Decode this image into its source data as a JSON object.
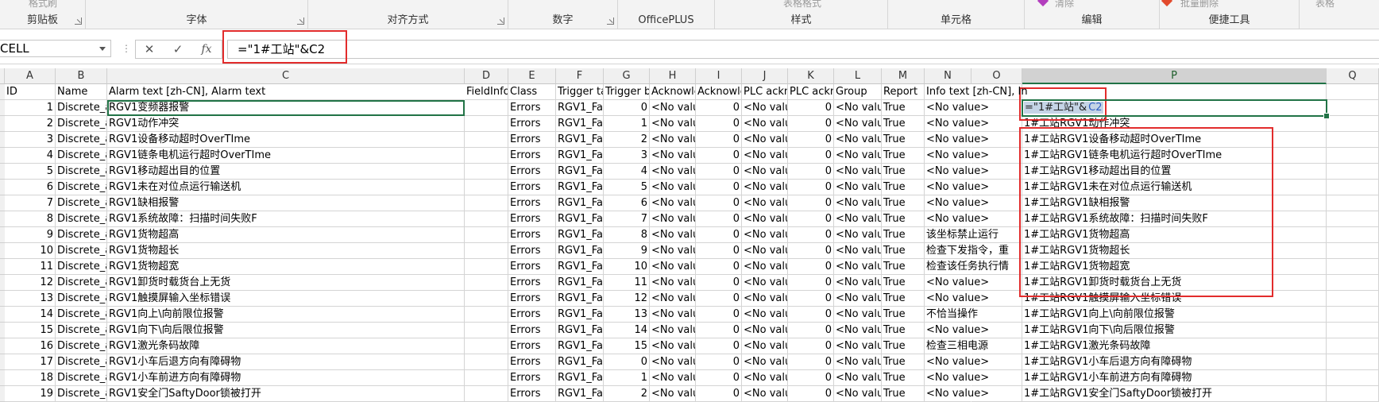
{
  "ribbon": {
    "groups": [
      {
        "label": "剪贴板",
        "faded": "格式刷"
      },
      {
        "label": "字体",
        "faded": ""
      },
      {
        "label": "对齐方式",
        "faded": ""
      },
      {
        "label": "数字",
        "faded": ""
      },
      {
        "label": "OfficePLUS",
        "faded": ""
      },
      {
        "label": "样式",
        "faded": "表格格式"
      },
      {
        "label": "单元格",
        "faded": ""
      },
      {
        "label": "编辑",
        "faded": "清除"
      },
      {
        "label": "便捷工具",
        "faded": "批量删除"
      },
      {
        "label": "",
        "faded": "表格"
      }
    ]
  },
  "formula_bar": {
    "name_box": "CELL",
    "cancel_icon": "✕",
    "enter_icon": "✓",
    "fx_label": "fx",
    "formula": "=\"1#工站\"&C2"
  },
  "columns": [
    {
      "letter": "A",
      "header": "ID"
    },
    {
      "letter": "B",
      "header": "Name"
    },
    {
      "letter": "C",
      "header": "Alarm text [zh-CN], Alarm text"
    },
    {
      "letter": "D",
      "header": "FieldInfo"
    },
    {
      "letter": "E",
      "header": "Class"
    },
    {
      "letter": "F",
      "header": "Trigger ta"
    },
    {
      "letter": "G",
      "header": "Trigger b"
    },
    {
      "letter": "H",
      "header": "Acknowle"
    },
    {
      "letter": "I",
      "header": "Acknowle"
    },
    {
      "letter": "J",
      "header": "PLC ackno"
    },
    {
      "letter": "K",
      "header": "PLC ackno"
    },
    {
      "letter": "L",
      "header": "Group"
    },
    {
      "letter": "M",
      "header": "Report"
    },
    {
      "letter": "N",
      "header": "Info text [zh-CN], In"
    },
    {
      "letter": "O",
      "header": ""
    },
    {
      "letter": "P",
      "header": ""
    },
    {
      "letter": "Q",
      "header": ""
    }
  ],
  "editing_cell": {
    "before": "=\"1#工站\"&",
    "ref": "C2"
  },
  "rows": [
    {
      "id": "1",
      "name": "Discrete_a",
      "text": "RGV1变频器报警",
      "cls": "Errors",
      "tag": "RGV1_Fa",
      "bit": "0",
      "ack": "<No valu",
      "ack2": "0",
      "plc": "<No valu",
      "plc2": "0",
      "group": "<No valu",
      "report": "True",
      "info": "<No value>",
      "p": ""
    },
    {
      "id": "2",
      "name": "Discrete_a",
      "text": "RGV1动作冲突",
      "cls": "Errors",
      "tag": "RGV1_Fa",
      "bit": "1",
      "ack": "<No valu",
      "ack2": "0",
      "plc": "<No valu",
      "plc2": "0",
      "group": "<No valu",
      "report": "True",
      "info": "<No value>",
      "p": "1#工站RGV1动作冲突"
    },
    {
      "id": "3",
      "name": "Discrete_a",
      "text": "RGV1设备移动超时OverTIme",
      "cls": "Errors",
      "tag": "RGV1_Fa",
      "bit": "2",
      "ack": "<No valu",
      "ack2": "0",
      "plc": "<No valu",
      "plc2": "0",
      "group": "<No valu",
      "report": "True",
      "info": "<No value>",
      "p": "1#工站RGV1设备移动超时OverTIme"
    },
    {
      "id": "4",
      "name": "Discrete_a",
      "text": "RGV1链条电机运行超时OverTIme",
      "cls": "Errors",
      "tag": "RGV1_Fa",
      "bit": "3",
      "ack": "<No valu",
      "ack2": "0",
      "plc": "<No valu",
      "plc2": "0",
      "group": "<No valu",
      "report": "True",
      "info": "<No value>",
      "p": "1#工站RGV1链条电机运行超时OverTIme"
    },
    {
      "id": "5",
      "name": "Discrete_a",
      "text": "RGV1移动超出目的位置",
      "cls": "Errors",
      "tag": "RGV1_Fa",
      "bit": "4",
      "ack": "<No valu",
      "ack2": "0",
      "plc": "<No valu",
      "plc2": "0",
      "group": "<No valu",
      "report": "True",
      "info": "<No value>",
      "p": "1#工站RGV1移动超出目的位置"
    },
    {
      "id": "6",
      "name": "Discrete_a",
      "text": "RGV1未在对位点运行输送机",
      "cls": "Errors",
      "tag": "RGV1_Fa",
      "bit": "5",
      "ack": "<No valu",
      "ack2": "0",
      "plc": "<No valu",
      "plc2": "0",
      "group": "<No valu",
      "report": "True",
      "info": "<No value>",
      "p": "1#工站RGV1未在对位点运行输送机"
    },
    {
      "id": "7",
      "name": "Discrete_a",
      "text": "RGV1缺相报警",
      "cls": "Errors",
      "tag": "RGV1_Fa",
      "bit": "6",
      "ack": "<No valu",
      "ack2": "0",
      "plc": "<No valu",
      "plc2": "0",
      "group": "<No valu",
      "report": "True",
      "info": "<No value>",
      "p": "1#工站RGV1缺相报警"
    },
    {
      "id": "8",
      "name": "Discrete_a",
      "text": "RGV1系统故障：扫描时间失败F",
      "cls": "Errors",
      "tag": "RGV1_Fa",
      "bit": "7",
      "ack": "<No valu",
      "ack2": "0",
      "plc": "<No valu",
      "plc2": "0",
      "group": "<No valu",
      "report": "True",
      "info": "<No value>",
      "p": "1#工站RGV1系统故障：扫描时间失败F"
    },
    {
      "id": "9",
      "name": "Discrete_a",
      "text": "RGV1货物超高",
      "cls": "Errors",
      "tag": "RGV1_Fa",
      "bit": "8",
      "ack": "<No valu",
      "ack2": "0",
      "plc": "<No valu",
      "plc2": "0",
      "group": "<No valu",
      "report": "True",
      "info": "该坐标禁止运行",
      "p": "1#工站RGV1货物超高"
    },
    {
      "id": "10",
      "name": "Discrete_a",
      "text": "RGV1货物超长",
      "cls": "Errors",
      "tag": "RGV1_Fa",
      "bit": "9",
      "ack": "<No valu",
      "ack2": "0",
      "plc": "<No valu",
      "plc2": "0",
      "group": "<No valu",
      "report": "True",
      "info": "检查下发指令，重",
      "p": "1#工站RGV1货物超长"
    },
    {
      "id": "11",
      "name": "Discrete_a",
      "text": "RGV1货物超宽",
      "cls": "Errors",
      "tag": "RGV1_Fa",
      "bit": "10",
      "ack": "<No valu",
      "ack2": "0",
      "plc": "<No valu",
      "plc2": "0",
      "group": "<No valu",
      "report": "True",
      "info": "检查该任务执行情",
      "p": "1#工站RGV1货物超宽"
    },
    {
      "id": "12",
      "name": "Discrete_a",
      "text": "RGV1卸货时载货台上无货",
      "cls": "Errors",
      "tag": "RGV1_Fa",
      "bit": "11",
      "ack": "<No valu",
      "ack2": "0",
      "plc": "<No valu",
      "plc2": "0",
      "group": "<No valu",
      "report": "True",
      "info": "<No value>",
      "p": "1#工站RGV1卸货时载货台上无货"
    },
    {
      "id": "13",
      "name": "Discrete_a",
      "text": "RGV1触摸屏输入坐标错误",
      "cls": "Errors",
      "tag": "RGV1_Fa",
      "bit": "12",
      "ack": "<No valu",
      "ack2": "0",
      "plc": "<No valu",
      "plc2": "0",
      "group": "<No valu",
      "report": "True",
      "info": "<No value>",
      "p": "1#工站RGV1触摸屏输入坐标错误"
    },
    {
      "id": "14",
      "name": "Discrete_a",
      "text": "RGV1向上\\向前限位报警",
      "cls": "Errors",
      "tag": "RGV1_Fa",
      "bit": "13",
      "ack": "<No valu",
      "ack2": "0",
      "plc": "<No valu",
      "plc2": "0",
      "group": "<No valu",
      "report": "True",
      "info": "不恰当操作",
      "p": "1#工站RGV1向上\\向前限位报警"
    },
    {
      "id": "15",
      "name": "Discrete_a",
      "text": "RGV1向下\\向后限位报警",
      "cls": "Errors",
      "tag": "RGV1_Fa",
      "bit": "14",
      "ack": "<No valu",
      "ack2": "0",
      "plc": "<No valu",
      "plc2": "0",
      "group": "<No valu",
      "report": "True",
      "info": "<No value>",
      "p": "1#工站RGV1向下\\向后限位报警"
    },
    {
      "id": "16",
      "name": "Discrete_a",
      "text": "RGV1激光条码故障",
      "cls": "Errors",
      "tag": "RGV1_Fa",
      "bit": "15",
      "ack": "<No valu",
      "ack2": "0",
      "plc": "<No valu",
      "plc2": "0",
      "group": "<No valu",
      "report": "True",
      "info": "检查三相电源",
      "p": "1#工站RGV1激光条码故障"
    },
    {
      "id": "17",
      "name": "Discrete_a",
      "text": "RGV1小车后退方向有障碍物",
      "cls": "Errors",
      "tag": "RGV1_Fa",
      "bit": "0",
      "ack": "<No valu",
      "ack2": "0",
      "plc": "<No valu",
      "plc2": "0",
      "group": "<No valu",
      "report": "True",
      "info": "<No value>",
      "p": "1#工站RGV1小车后退方向有障碍物"
    },
    {
      "id": "18",
      "name": "Discrete_a",
      "text": "RGV1小车前进方向有障碍物",
      "cls": "Errors",
      "tag": "RGV1_Fa",
      "bit": "1",
      "ack": "<No valu",
      "ack2": "0",
      "plc": "<No valu",
      "plc2": "0",
      "group": "<No valu",
      "report": "True",
      "info": "<No value>",
      "p": "1#工站RGV1小车前进方向有障碍物"
    },
    {
      "id": "19",
      "name": "Discrete_a",
      "text": "RGV1安全门SaftyDoor锁被打开",
      "cls": "Errors",
      "tag": "RGV1_Fa",
      "bit": "2",
      "ack": "<No valu",
      "ack2": "0",
      "plc": "<No valu",
      "plc2": "0",
      "group": "<No valu",
      "report": "True",
      "info": "<No value>",
      "p": "1#工站RGV1安全门SaftyDoor锁被打开"
    }
  ],
  "colors": {
    "highlight_box": "#e22c2c",
    "selection_green": "#217346",
    "ref_blue": "#2f5ec4"
  }
}
